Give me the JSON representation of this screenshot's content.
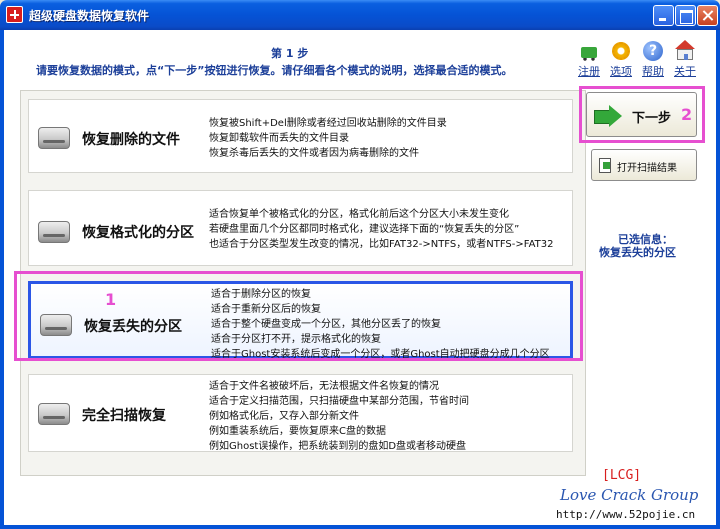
{
  "window": {
    "title": "超级硬盘数据恢复软件",
    "icon": "app-logo-icon"
  },
  "header": {
    "step": "第 1 步",
    "instruction": "请要恢复数据的模式，点“下一步”按钮进行恢复。请仔细看各个模式的说明，选择最合适的模式。"
  },
  "toolbar": [
    {
      "label": "注册",
      "icon": "cart-icon"
    },
    {
      "label": "选项",
      "icon": "gear-icon"
    },
    {
      "label": "帮助",
      "icon": "help-icon"
    },
    {
      "label": "关于",
      "icon": "home-icon"
    }
  ],
  "options": [
    {
      "title": "恢复删除的文件",
      "desc": [
        "恢复被Shift+Del删除或者经过回收站删除的文件目录",
        "恢复卸载软件而丢失的文件目录",
        "恢复杀毒后丢失的文件或者因为病毒删除的文件"
      ]
    },
    {
      "title": "恢复格式化的分区",
      "desc": [
        "适合恢复单个被格式化的分区，格式化前后这个分区大小未发生变化",
        "若硬盘里面几个分区都同时格式化，建议选择下面的“恢复丢失的分区”",
        "也适合于分区类型发生改变的情况，比如FAT32->NTFS，或者NTFS->FAT32"
      ]
    },
    {
      "title": "恢复丢失的分区",
      "selected": true,
      "desc": [
        "适合于删除分区的恢复",
        "适合于重新分区后的恢复",
        "适合于整个硬盘变成一个分区，其他分区丢了的恢复",
        "适合于分区打不开，提示格式化的恢复",
        "适合于Ghost安装系统后变成一个分区，或者Ghost自动把硬盘分成几个分区"
      ]
    },
    {
      "title": "完全扫描恢复",
      "desc": [
        "适合于文件名被破坏后，无法根据文件名恢复的情况",
        "适合于定义扫描范围，只扫描硬盘中某部分范围，节省时间",
        "例如格式化后，又存入部分新文件",
        "例如重装系统后，要恢复原来C盘的数据",
        "例如Ghost误操作，把系统装到别的盘如D盘或者移动硬盘"
      ]
    }
  ],
  "annotations": {
    "one": "1",
    "two": "2"
  },
  "buttons": {
    "next": "下一步",
    "open_results": "打开扫描结果"
  },
  "selection": {
    "title": "已选信息：",
    "value": "恢复丢失的分区"
  },
  "watermark": {
    "tag": "[LCG]",
    "name": "Love Crack Group",
    "url": "http://www.52pojie.cn"
  },
  "colors": {
    "accent": "#1c3f99",
    "highlight": "#e64fd0",
    "selected_border": "#2b56e6",
    "titlebar": "#0553d6"
  }
}
